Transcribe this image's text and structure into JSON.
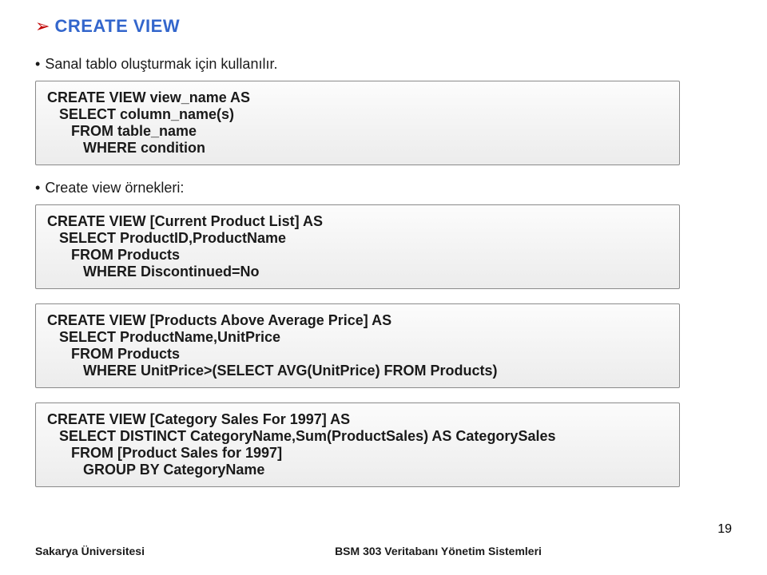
{
  "title": "CREATE  VIEW",
  "bullet1": "Sanal tablo oluşturmak için kullanılır.",
  "bullet2": "Create view örnekleri:",
  "box1": {
    "l1": "CREATE VIEW view_name AS",
    "l2": "   SELECT column_name(s)",
    "l3": "      FROM table_name",
    "l4": "         WHERE condition"
  },
  "box2": {
    "l1": "CREATE VIEW [Current Product List] AS",
    "l2": "   SELECT ProductID,ProductName",
    "l3": "      FROM Products",
    "l4": "         WHERE Discontinued=No"
  },
  "box3": {
    "l1": "CREATE VIEW [Products Above Average Price] AS",
    "l2": "   SELECT ProductName,UnitPrice",
    "l3": "      FROM Products",
    "l4": "         WHERE UnitPrice>(SELECT AVG(UnitPrice) FROM Products)"
  },
  "box4": {
    "l1": "CREATE VIEW [Category Sales For 1997] AS",
    "l2": "   SELECT DISTINCT CategoryName,Sum(ProductSales) AS CategorySales",
    "l3": "      FROM [Product Sales for 1997]",
    "l4": "         GROUP BY CategoryName"
  },
  "footer": {
    "left": "Sakarya Üniversitesi",
    "center": "BSM 303 Veritabanı Yönetim Sistemleri",
    "page": "19"
  }
}
